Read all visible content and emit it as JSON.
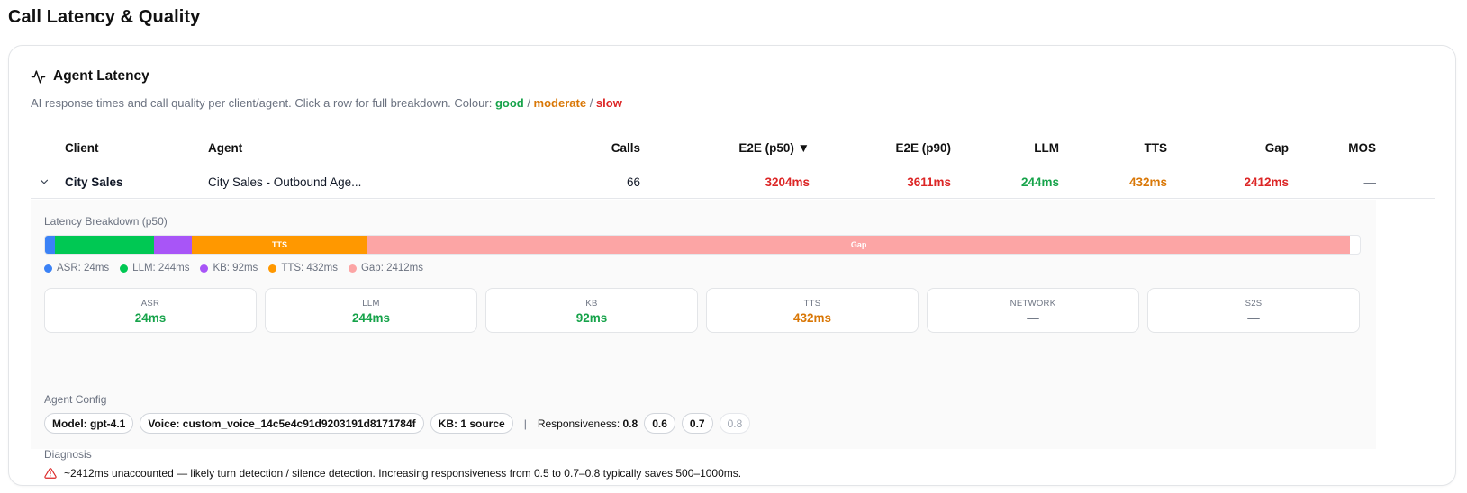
{
  "page": {
    "title": "Call Latency & Quality"
  },
  "card": {
    "title": "Agent Latency",
    "icon": "activity-icon",
    "description": "AI response times and call quality per client/agent. Click a row for full breakdown. Colour:",
    "legend_good": "good",
    "legend_slash1": " / ",
    "legend_moderate": "moderate",
    "legend_slash2": " / ",
    "legend_slow": "slow"
  },
  "colors": {
    "good": "#16a34a",
    "moderate": "#d97706",
    "slow": "#dc2626",
    "asr": "#3b82f6",
    "llm": "#00c853",
    "kb": "#a855f7",
    "tts": "#ff9800",
    "gap": "#fca5a5"
  },
  "table": {
    "headers": {
      "client": "Client",
      "agent": "Agent",
      "calls": "Calls",
      "e2e_p50": "E2E (p50) ▼",
      "e2e_p90": "E2E (p90)",
      "llm": "LLM",
      "tts": "TTS",
      "gap": "Gap",
      "mos": "MOS"
    },
    "rows": [
      {
        "client": "City Sales",
        "agent": "City Sales - Outbound Age...",
        "calls": "66",
        "e2e_p50": "3204ms",
        "e2e_p90": "3611ms",
        "llm": "244ms",
        "tts": "432ms",
        "gap": "2412ms",
        "mos": "—"
      }
    ]
  },
  "breakdown": {
    "title": "Latency Breakdown (p50)",
    "segments": [
      {
        "name": "ASR",
        "ms": 24,
        "label": "",
        "color": "#3b82f6"
      },
      {
        "name": "LLM",
        "ms": 244,
        "label": "",
        "color": "#00c853"
      },
      {
        "name": "KB",
        "ms": 92,
        "label": "",
        "color": "#a855f7"
      },
      {
        "name": "TTS",
        "ms": 432,
        "label": "TTS",
        "color": "#ff9800"
      },
      {
        "name": "Gap",
        "ms": 2412,
        "label": "Gap",
        "color": "#fca5a5"
      }
    ],
    "bar_total_ms": 3228,
    "legend": [
      {
        "text": "ASR: 24ms",
        "color": "#3b82f6"
      },
      {
        "text": "LLM: 244ms",
        "color": "#00c853"
      },
      {
        "text": "KB: 92ms",
        "color": "#a855f7"
      },
      {
        "text": "TTS: 432ms",
        "color": "#ff9800"
      },
      {
        "text": "Gap: 2412ms",
        "color": "#fca5a5"
      }
    ],
    "tiles": [
      {
        "label": "ASR",
        "value": "24ms",
        "status": "good"
      },
      {
        "label": "LLM",
        "value": "244ms",
        "status": "good"
      },
      {
        "label": "KB",
        "value": "92ms",
        "status": "good"
      },
      {
        "label": "TTS",
        "value": "432ms",
        "status": "moderate"
      },
      {
        "label": "NETWORK",
        "value": "—",
        "status": "none"
      },
      {
        "label": "S2S",
        "value": "—",
        "status": "none"
      }
    ]
  },
  "config": {
    "title": "Agent Config",
    "model": "Model: gpt-4.1",
    "voice": "Voice: custom_voice_14c5e4c91d9203191d8171784f",
    "kb": "KB: 1 source",
    "separator": "|",
    "responsiveness_label": "Responsiveness:",
    "responsiveness_value": "0.8",
    "options": [
      "0.6",
      "0.7",
      "0.8"
    ]
  },
  "diagnosis": {
    "title": "Diagnosis",
    "icon": "warning-icon",
    "text": "~2412ms unaccounted — likely turn detection / silence detection. Increasing responsiveness from 0.5 to 0.7–0.8 typically saves 500–1000ms."
  }
}
